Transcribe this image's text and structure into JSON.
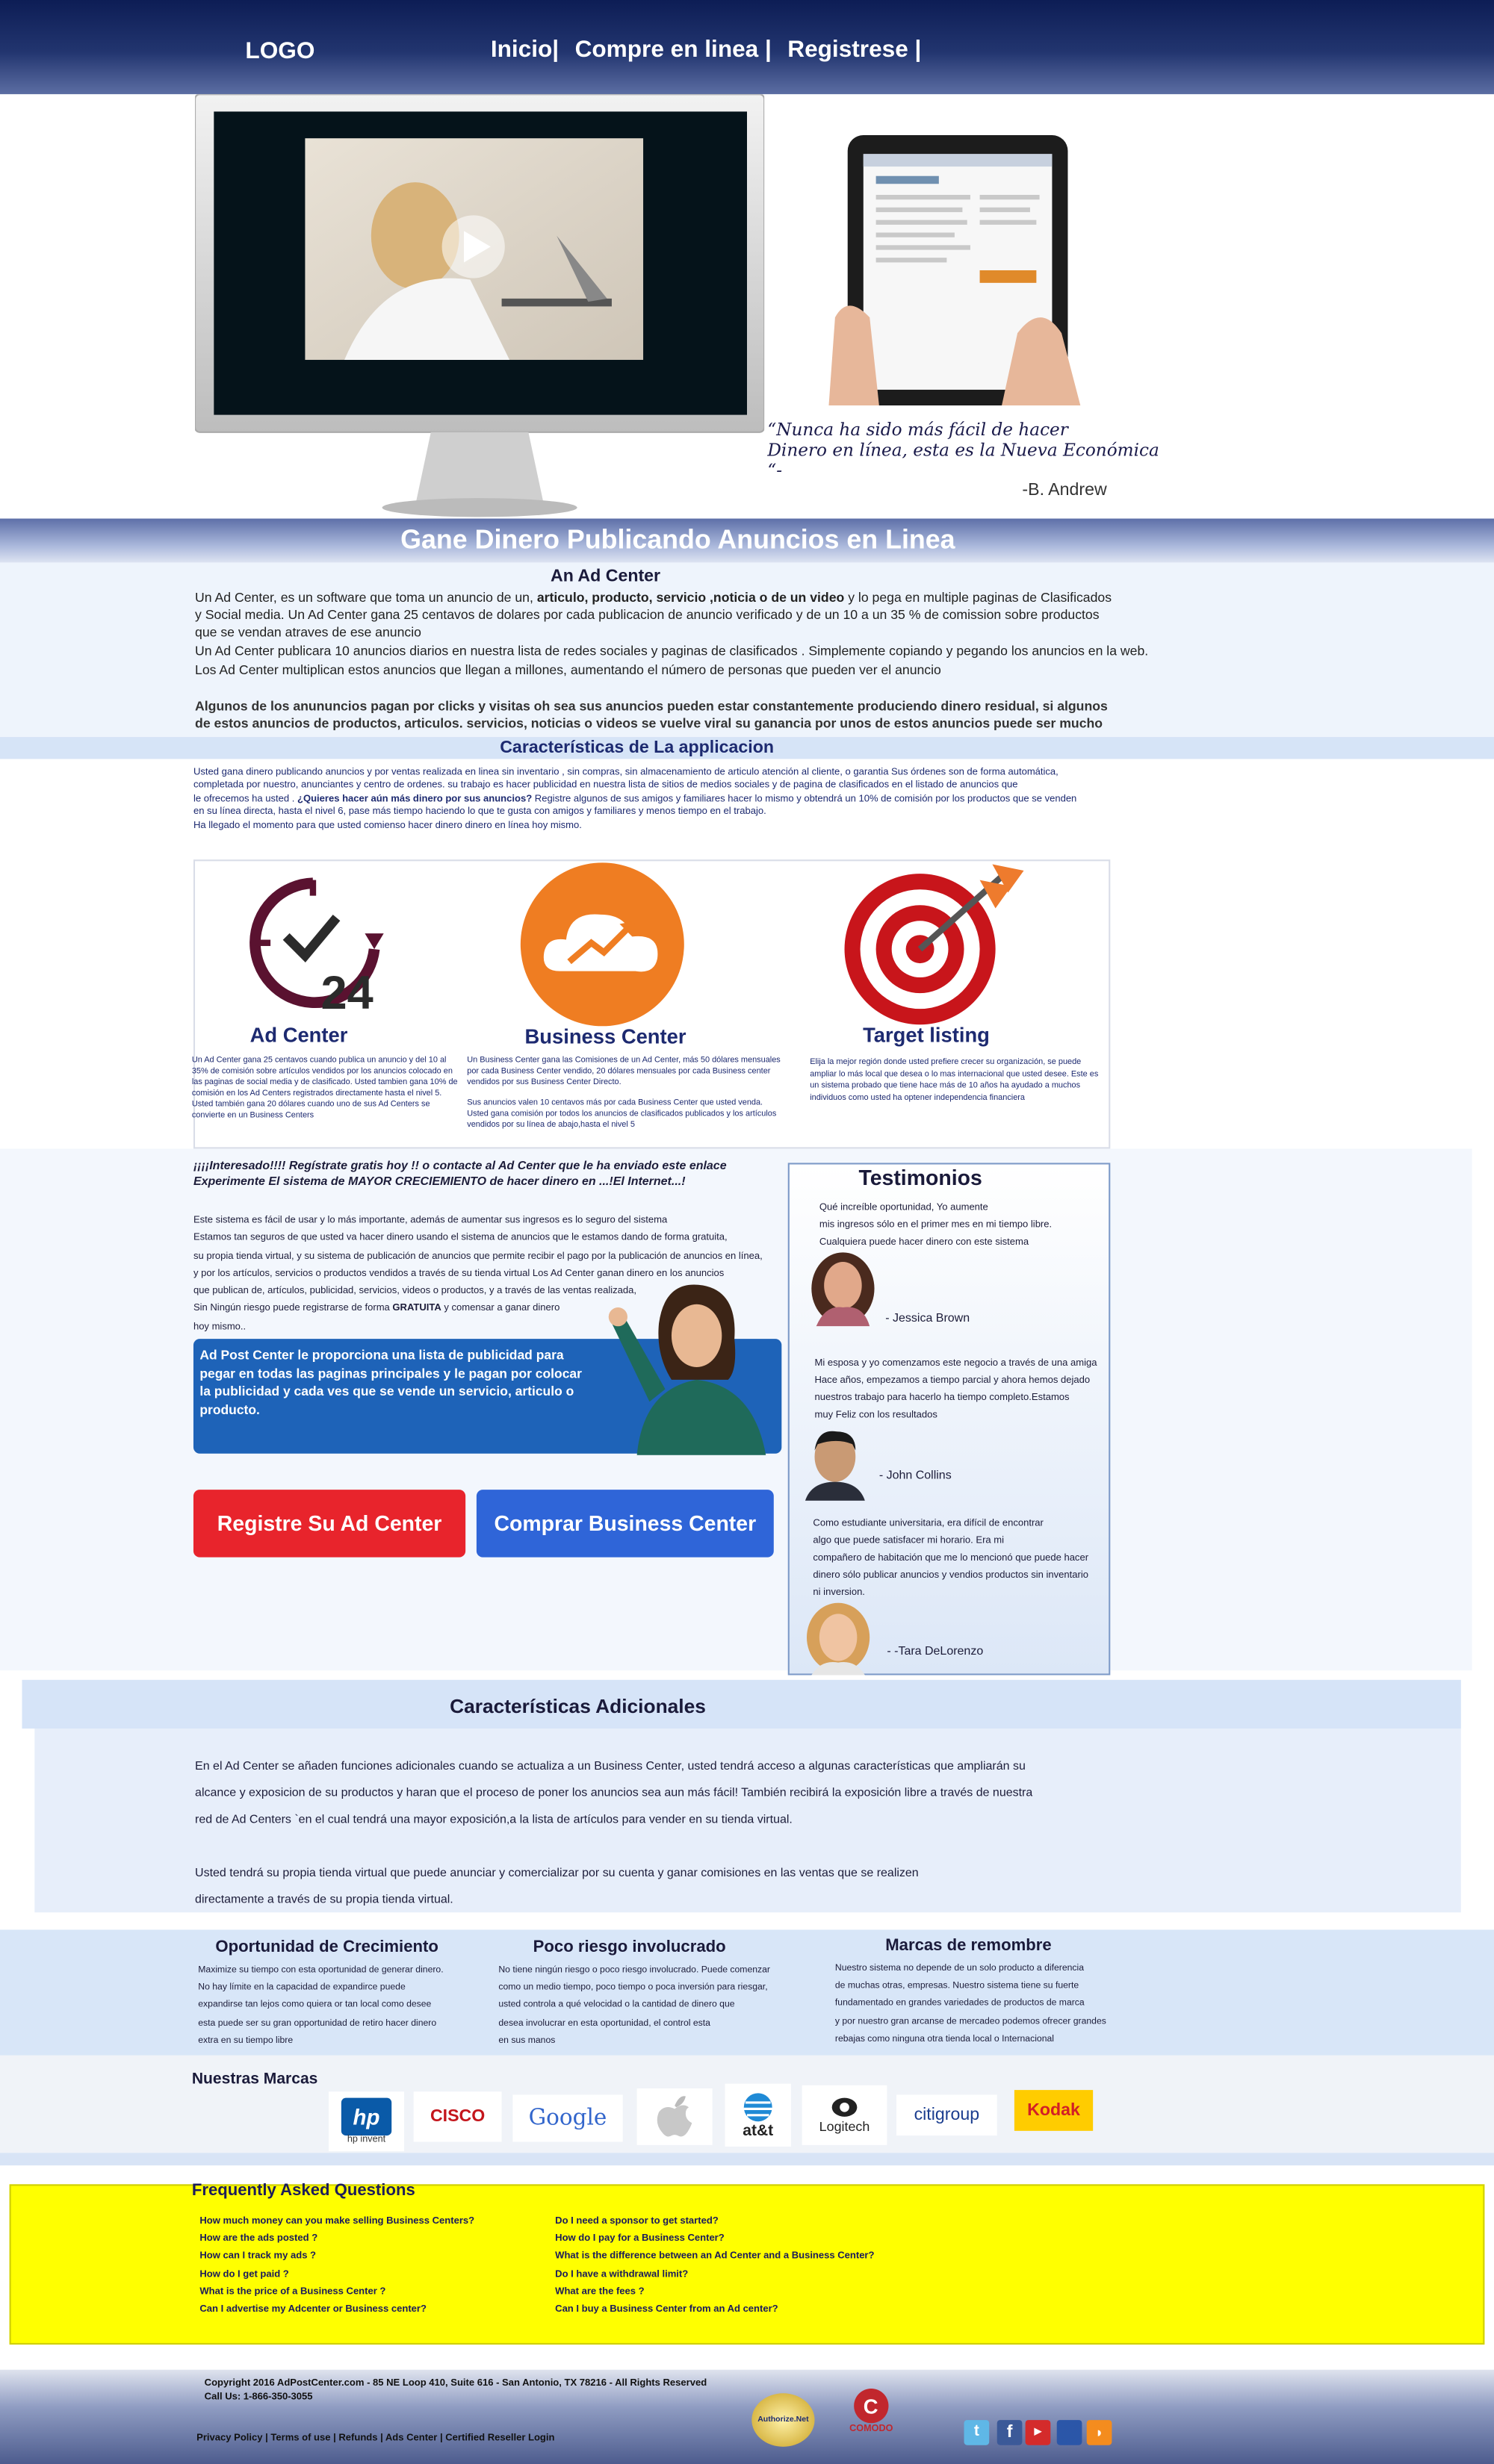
{
  "header": {
    "logo": "LOGO",
    "nav": [
      "Inicio|",
      "Compre en linea |",
      "Registrese |"
    ]
  },
  "hero": {
    "quote_line1": "“Nunca ha sido más fácil de hacer",
    "quote_line2": "Dinero en línea, esta es la Nueva Económica “-",
    "quote_author": "-B. Andrew"
  },
  "banner": {
    "title": "Gane Dinero Publicando Anuncios en Linea"
  },
  "intro": {
    "heading": "An Ad Center",
    "p1_a": "Un Ad Center, es un software que toma un anuncio de un, ",
    "p1_b": "articulo, producto, servicio ,noticia o de un video",
    "p1_c": " y lo pega en multiple paginas de  Clasificados y Social media. Un Ad Center gana 25 centavos de dolares por cada publicacion de anuncio verificado y de un 10 a un 35 % de comission sobre productos que se vendan atraves de ese anuncio",
    "p2": "Un Ad Center  publicara 10 anuncios diarios en nuestra lista de  redes sociales y paginas de clasificados . Simplemente copiando y pegando los anuncios en la web.",
    "p3": "Los Ad Center  multiplican estos anuncios que llegan a millones, aumentando el número de personas que pueden ver el anuncio",
    "p4": "Algunos de los anununcios pagan por clicks  y visitas oh sea sus anuncios pueden estar constantemente produciendo dinero residual, si algunos de estos anuncios de  productos, articulos. servicios, noticias o videos se vuelve viral su ganancia por unos de estos anuncios puede ser mucho mayor"
  },
  "app": {
    "heading": "Características de La applicacion",
    "line1": "Usted gana dinero publicando anuncios y  por ventas realizada  en linea sin inventario , sin compras, sin almacenamiento de articulo atención al cliente, o garantia  Sus órdenes son de forma automática,",
    "line2": "completada por nuestro, anunciantes y centro de ordenes. su trabajo es hacer publicidad en nuestra lista de sitios de medios sociales y de pagina de clasificados en el listado de anuncios que",
    "line3a": "le ofrecemos ha usted . ",
    "line3b": "¿Quieres hacer aún más dinero por  sus anuncios?",
    "line3c": " Registre algunos de sus amigos y familiares hacer lo mismo y obtendrá un 10% de comisión por los productos que se venden",
    "line4": " en su línea directa, hasta el nivel 6, pase más tiempo haciendo lo que te gusta con amigos y familiares y menos tiempo en el trabajo.",
    "line5": "Ha llegado el momento para que usted comienso hacer dinero  dinero en línea hoy mismo."
  },
  "features": [
    {
      "title": "Ad Center",
      "text1": "Un Ad Center gana 25 centavos cuando publica un anuncio y del 10 al 35% de comisión sobre artículos vendidos por los anuncios  colocado en las paginas de social media y de clasificado. Usted  tambien gana 10% de comisión en los Ad Centers   registrados directamente  hasta el nivel 5.",
      "text2": "Usted también  gana 20 dólares cuando uno de sus  Ad Centers se convierte en un  Business Centers"
    },
    {
      "title": "Business  Center",
      "text1": "Un Business Center gana las Comisiones de un  Ad Center, más 50 dólares mensuales por cada  Business Center vendido, 20 dólares mensuales por cada Business center  vendidos por sus Business Center Directo.",
      "text2": "Sus anuncios valen 10 centavos más por cada Business Center que  usted venda. Usted gana comisión por todos los anuncios de clasificados publicados y los artículos vendidos por su línea de abajo,hasta el nivel 5"
    },
    {
      "title": "Target listing",
      "text1": "Elija la mejor región donde usted prefiere crecer  su organización, se puede  ampliar lo más local que desea o  lo mas internacional que usted desee.  Este  es un sistema probado que tiene hace más de 10 años ha ayudado a muchos individuos como usted ha optener  independencia financiera",
      "text2": ""
    }
  ],
  "promo": {
    "headline1": "¡¡¡¡Interesado!!!!  Regístrate gratis hoy  !! o contacte al Ad Center que le ha enviado este enlace",
    "headline2": " Experimente  El sistema de  MAYOR CRECIEMIENTO de hacer dinero en ...!El Internet...!",
    "p1": "Este sistema es fácil de usar y lo más importante, además de aumentar sus ingresos es lo seguro del sistema",
    "p2": "Estamos tan seguros de que usted va hacer dinero usando el sistema de anuncios que le estamos dando de forma gratuita,",
    "p3": "su propia tienda  virtual, y su sistema de publicación de anuncios  que permite recibir el pago por la publicación de anuncios en línea,",
    "p4": "y por los artículos, servicios o productos vendidos a través de su tienda virtual  Los Ad Center ganan dinero en los anuncios",
    "p5": "que publican de, artículos, publicidad, servicios, videos o productos,  y a través de las ventas realizada,",
    "p6a": "Sin Ningún riesgo  puede  registrarse de forma ",
    "p6b": "GRATUITA",
    "p6c": "  y comensar a ganar dinero",
    "p7": "hoy mismo..",
    "card": " Ad Post Center le proporciona una lista de publicidad para pegar en todas las paginas principales y le pagan por colocar la publicidad y cada ves que se vende un servicio, articulo o producto.",
    "btn_register": "Registre Su Ad Center",
    "btn_buy": "Comprar Business Center"
  },
  "testimonials": {
    "heading": "Testimonios",
    "items": [
      {
        "lines": [
          "Qué increíble oportunidad, Yo aumente",
          "mis ingresos sólo en el primer mes en mi tiempo libre.",
          "Cualquiera puede hacer dinero con este sistema"
        ],
        "name": "- Jessica  Brown"
      },
      {
        "lines": [
          "Mi esposa y yo comenzamos este negocio a través de una amiga",
          "Hace años, empezamos a tiempo parcial y ahora hemos dejado",
          " nuestros  trabajo para hacerlo ha tiempo completo.Estamos",
          "muy Feliz con los resultados"
        ],
        "name": "- John Collins"
      },
      {
        "lines": [
          "Como estudiante universitaria, era difícil de encontrar",
          "algo que puede satisfacer mi horario. Era mi",
          "compañero de habitación que me lo mencionó que puede hacer",
          "dinero sólo publicar  anuncios y vendios productos sin inventario",
          "ni inversion."
        ],
        "name": "- -Tara DeLorenzo"
      }
    ]
  },
  "extra": {
    "heading": "Características Adicionales",
    "l1": "En el Ad Center se añaden funciones adicionales cuando se actualiza a un Business Center, usted tendrá acceso a algunas características que ampliarán su",
    "l2": "alcance y exposicion de su productos y haran que el proceso de poner los anuncios  sea aun más fácil! También recibirá la exposición libre a través de nuestra",
    "l3": "red de  Ad Centers `en el cual tendrá una mayor exposición,a la lista de artículos para vender en su tienda virtual.",
    "l4": "Usted tendrá su propia tienda virtual que puede anunciar y comercializar por su cuenta y ganar comisiones en las ventas que se realizen",
    "l5": "directamente a través de su propia tienda virtual."
  },
  "three": [
    {
      "title": "Oportunidad de Crecimiento",
      "lines": [
        "Maximize su tiempo con esta oportunidad de generar dinero.",
        "No hay límite en la capacidad de expandirce  puede",
        "expandirse  tan lejos como quiera or tan local como desee",
        " esta puede ser su gran opportunidad de retiro hacer dinero",
        "extra en su tiempo libre"
      ]
    },
    {
      "title": "Poco riesgo involucrado",
      "lines": [
        "No tiene ningún riesgo o poco riesgo involucrado. Puede comenzar",
        "como un medio tiempo,  poco tiempo o poca inversión para riesgar,",
        "usted controla a qué velocidad o la cantidad de dinero que",
        "desea involucrar en esta oportunidad, el control esta",
        "en sus manos"
      ]
    },
    {
      "title": "Marcas de remombre",
      "lines": [
        "Nuestro sistema no depende de un solo producto a diferencia",
        "de muchas otras, empresas. Nuestro sistema tiene su fuerte",
        "fundamentado en  grandes variedades de productos de marca",
        "y por nuestro gran arcanse de mercadeo podemos ofrecer grandes",
        " rebajas  como ninguna otra tienda local o Internacional"
      ]
    }
  ],
  "brands": {
    "heading": "Nuestras Marcas",
    "items": [
      "hp invent",
      "CISCO",
      "Google",
      "Apple",
      "at&t",
      "Logitech",
      "citigroup",
      "Kodak"
    ]
  },
  "faq": {
    "heading": "Frequently Asked Questions",
    "left": [
      "How much money can you make selling Business Centers?",
      "How are the ads posted ?",
      "How  can  I track my ads ?",
      "How do I get paid ?",
      "What is the price of a Business Center ?",
      "Can I advertise my Adcenter or Business center?"
    ],
    "right": [
      "Do  I need a sponsor to  get started?",
      "How do I pay for a Business Center?",
      "What is the difference between an Ad Center and a Business Center?",
      "Do I have a withdrawal limit?",
      "What are  the fees ?",
      "Can I buy a Business Center from an Ad center?"
    ]
  },
  "footer": {
    "copyright": "Copyright 2016 AdPostCenter.com - 85 NE Loop 410, Suite 616 - San Antonio, TX 78216 - All Rights Reserved",
    "call": "Call Us: 1-866-350-3055",
    "links": "Privacy Policy | Terms of use | Refunds | Ads Center | Certified Reseller Login",
    "badges": [
      "Authorize.Net",
      "COMODO"
    ],
    "social_icons": [
      "twitter-icon",
      "facebook-icon",
      "youtube-icon",
      "myspace-icon",
      "rss-icon"
    ]
  }
}
